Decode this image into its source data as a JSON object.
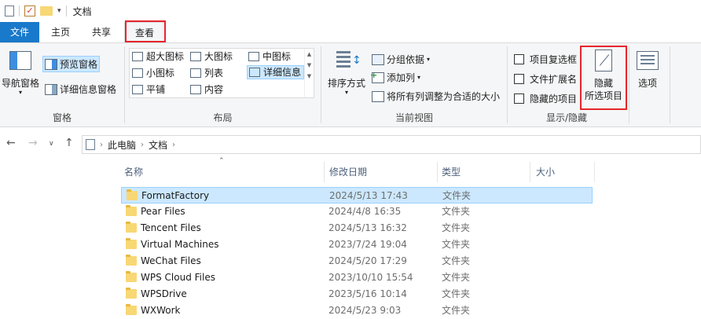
{
  "window": {
    "title": "文档"
  },
  "tabs": {
    "file": "文件",
    "home": "主页",
    "share": "共享",
    "view": "查看"
  },
  "ribbon": {
    "panes": {
      "nav_pane": "导航窗格",
      "preview_pane": "预览窗格",
      "details_pane": "详细信息窗格",
      "label": "窗格"
    },
    "layout": {
      "items": [
        "超大图标",
        "大图标",
        "中图标",
        "小图标",
        "列表",
        "详细信息",
        "平铺",
        "内容"
      ],
      "label": "布局"
    },
    "current_view": {
      "sort_by": "排序方式",
      "group_by": "分组依据",
      "add_column": "添加列",
      "fit_columns": "将所有列调整为合适的大小",
      "label": "当前视图"
    },
    "show_hide": {
      "item_checkbox": "项目复选框",
      "file_ext": "文件扩展名",
      "hidden_items": "隐藏的项目",
      "hide_selected_1": "隐藏",
      "hide_selected_2": "所选项目",
      "label": "显示/隐藏"
    },
    "options": "选项"
  },
  "address": {
    "crumbs": [
      "此电脑",
      "文档"
    ]
  },
  "columns": {
    "name": "名称",
    "date": "修改日期",
    "type": "类型",
    "size": "大小"
  },
  "files": [
    {
      "name": "FormatFactory",
      "date": "2024/5/13 17:43",
      "type": "文件夹"
    },
    {
      "name": "Pear Files",
      "date": "2024/4/8 16:35",
      "type": "文件夹"
    },
    {
      "name": "Tencent Files",
      "date": "2024/5/13 16:32",
      "type": "文件夹"
    },
    {
      "name": "Virtual Machines",
      "date": "2023/7/24 19:04",
      "type": "文件夹"
    },
    {
      "name": "WeChat Files",
      "date": "2024/5/20 17:29",
      "type": "文件夹"
    },
    {
      "name": "WPS Cloud Files",
      "date": "2023/10/10 15:54",
      "type": "文件夹"
    },
    {
      "name": "WPSDrive",
      "date": "2023/5/16 10:14",
      "type": "文件夹"
    },
    {
      "name": "WXWork",
      "date": "2024/5/23 9:03",
      "type": "文件夹"
    }
  ]
}
